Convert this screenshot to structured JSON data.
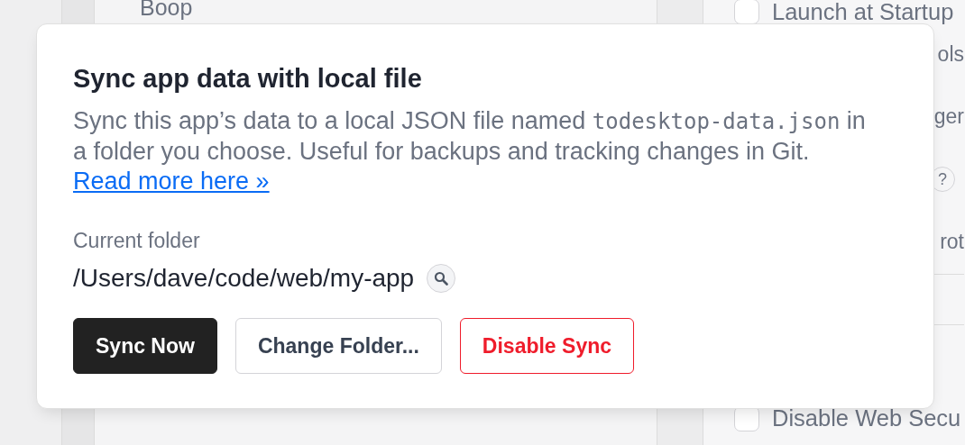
{
  "background": {
    "list_item": "Boop",
    "settings": [
      {
        "kind": "checkbox",
        "label": "Launch at Startup",
        "checked": false
      },
      {
        "kind": "text",
        "label": "ols"
      },
      {
        "kind": "text",
        "label": "ger"
      },
      {
        "kind": "help",
        "label": "?"
      },
      {
        "kind": "text",
        "label": "rot"
      },
      {
        "kind": "divider"
      },
      {
        "kind": "divider"
      },
      {
        "kind": "checkbox",
        "label": "Disable Web Secu",
        "checked": false
      }
    ]
  },
  "dialog": {
    "title": "Sync app data with local file",
    "description": {
      "before": "Sync this app’s data to a local JSON file named ",
      "code": "todesktop-data.json",
      "after": " in a folder you choose. Useful for backups and tracking changes in Git."
    },
    "link": "Read more here »",
    "folder_label": "Current folder",
    "folder_path": "/Users/dave/code/web/my-app",
    "buttons": [
      {
        "kind": "primary",
        "label": "Sync Now"
      },
      {
        "kind": "secondary",
        "label": "Change Folder..."
      },
      {
        "kind": "danger",
        "label": "Disable Sync"
      }
    ]
  }
}
